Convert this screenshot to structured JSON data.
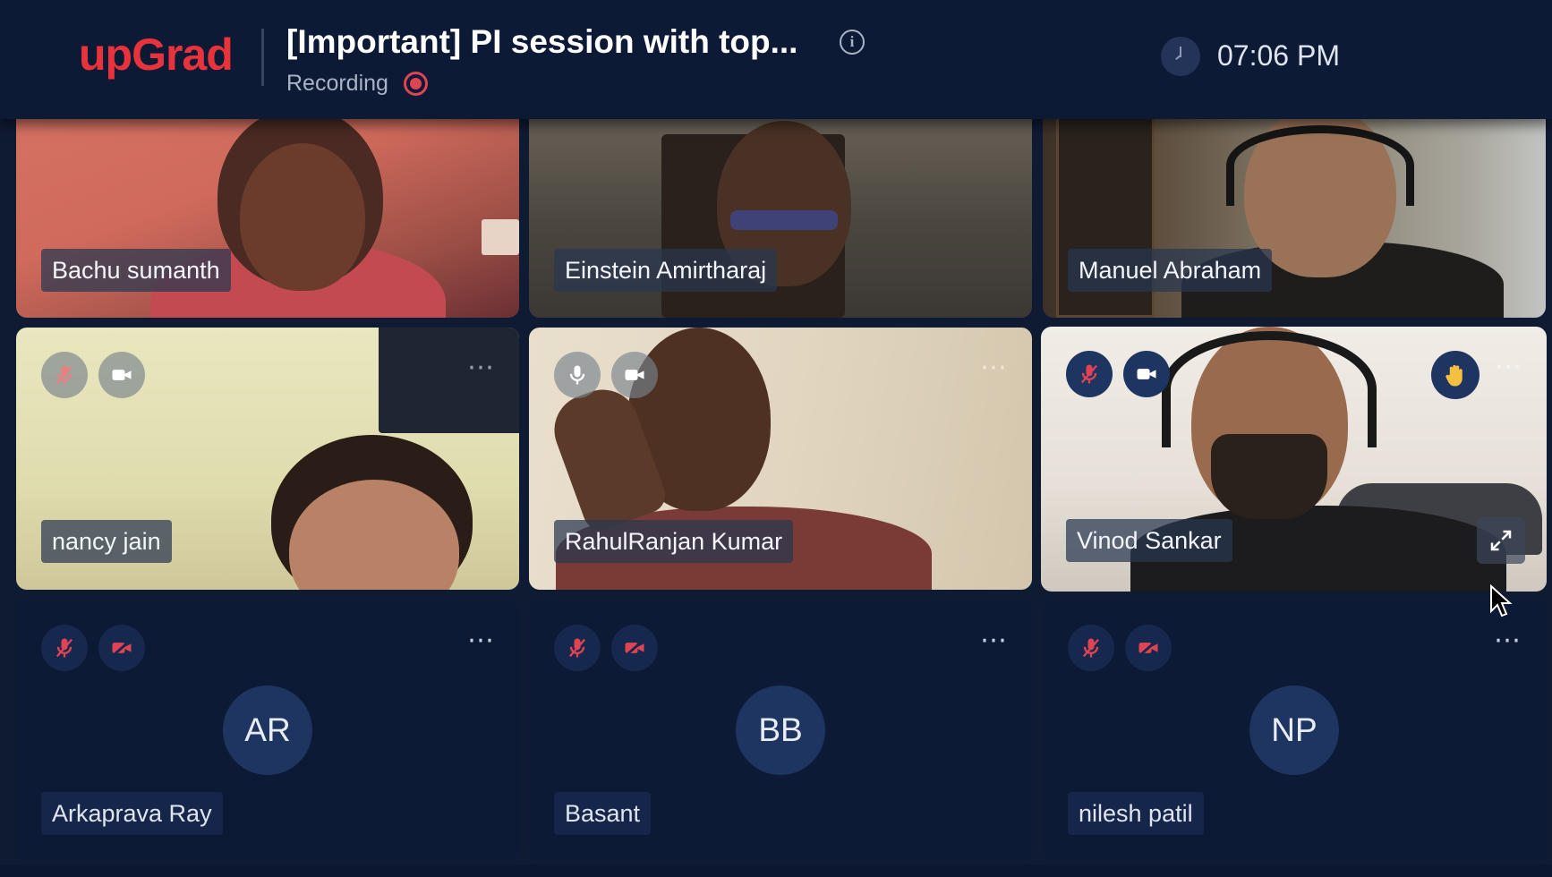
{
  "header": {
    "logo": "upGrad",
    "title": "[Important] PI session with top...",
    "recording_label": "Recording",
    "time": "07:06 PM"
  },
  "participants": [
    {
      "name": "Bachu sumanth",
      "video": true
    },
    {
      "name": "Einstein Amirtharaj",
      "video": true
    },
    {
      "name": "Manuel Abraham",
      "video": true
    },
    {
      "name": "nancy jain",
      "video": true,
      "mic": "muted",
      "camera": "on"
    },
    {
      "name": "RahulRanjan Kumar",
      "video": true,
      "mic": "on",
      "camera": "on"
    },
    {
      "name": "Vinod Sankar",
      "video": true,
      "mic": "muted",
      "camera": "on",
      "hand_raised": true
    },
    {
      "name": "Arkaprava Ray",
      "initials": "AR",
      "video": false,
      "mic": "muted",
      "camera": "off"
    },
    {
      "name": "Basant",
      "initials": "BB",
      "video": false,
      "mic": "muted",
      "camera": "off"
    },
    {
      "name": "nilesh patil",
      "initials": "NP",
      "video": false,
      "mic": "muted",
      "camera": "off"
    }
  ],
  "colors": {
    "brand": "#e8333d",
    "background": "#0d1a35",
    "muted": "#e04454"
  },
  "icons": {
    "menu": "⋯"
  }
}
